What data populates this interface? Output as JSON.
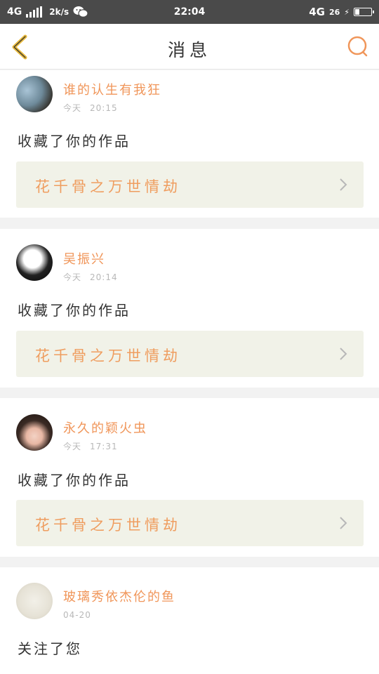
{
  "status_bar": {
    "network": "4G",
    "speed": "2k/s",
    "time": "22:04",
    "network_right": "4G",
    "battery": "26"
  },
  "header": {
    "title": "消息",
    "back_icon": "chevron-left-icon",
    "search_icon": "search-icon"
  },
  "colors": {
    "accent": "#f0965a",
    "back_icon": "#e8b93a",
    "card_bg": "#f1f2e8"
  },
  "messages": [
    {
      "user": "谁的认生有我狂",
      "date": "今天",
      "time": "20:15",
      "action": "收藏了你的作品",
      "work": "花千骨之万世情劫"
    },
    {
      "user": "吴振兴",
      "date": "今天",
      "time": "20:14",
      "action": "收藏了你的作品",
      "work": "花千骨之万世情劫"
    },
    {
      "user": "永久的颖火虫",
      "date": "今天",
      "time": "17:31",
      "action": "收藏了你的作品",
      "work": "花千骨之万世情劫"
    },
    {
      "user": "玻璃秀依杰伦的鱼",
      "date": "04-20",
      "action": "关注了您"
    }
  ]
}
